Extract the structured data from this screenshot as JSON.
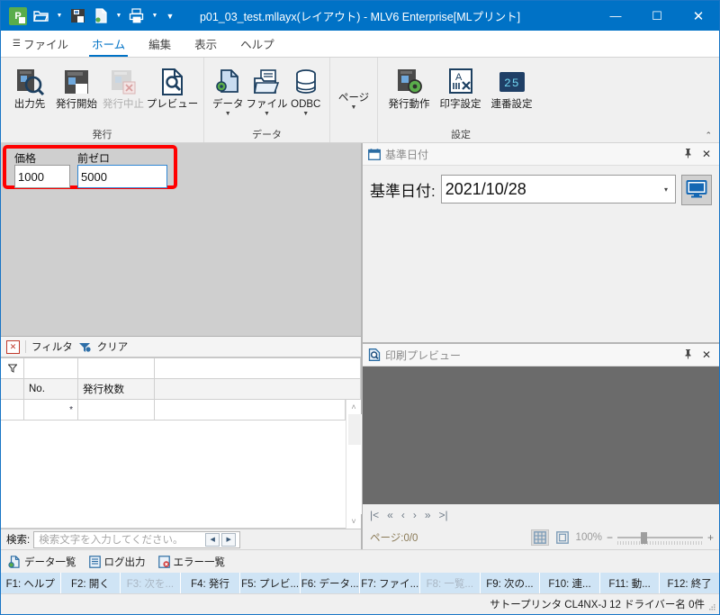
{
  "titlebar": {
    "title": "p01_03_test.mllayx(レイアウト) - MLV6 Enterprise[MLプリント]",
    "quick_access": [
      {
        "name": "app-logo",
        "label": "P"
      },
      {
        "name": "open-icon",
        "label": "open"
      },
      {
        "name": "save-icon",
        "label": "save"
      },
      {
        "name": "new-data-icon",
        "label": "new"
      },
      {
        "name": "print-icon",
        "label": "print"
      }
    ],
    "minimize": "—",
    "maximize": "☐",
    "close": "✕"
  },
  "tabs": [
    {
      "label": "ファイル",
      "active": false,
      "hamburger": true
    },
    {
      "label": "ホーム",
      "active": true
    },
    {
      "label": "編集",
      "active": false
    },
    {
      "label": "表示",
      "active": false
    },
    {
      "label": "ヘルプ",
      "active": false
    }
  ],
  "ribbon": {
    "collapse_glyph": "⌃",
    "groups": [
      {
        "name": "発行",
        "label": "発行",
        "buttons": [
          {
            "label": "出力先",
            "icon": "output-destination-icon",
            "disabled": false,
            "dropdown": false
          },
          {
            "label": "発行開始",
            "icon": "start-issue-icon",
            "disabled": false,
            "dropdown": false
          },
          {
            "label": "発行中止",
            "icon": "cancel-issue-icon",
            "disabled": true,
            "dropdown": false
          },
          {
            "label": "プレビュー",
            "icon": "preview-icon",
            "disabled": false,
            "dropdown": false
          }
        ]
      },
      {
        "name": "データ",
        "label": "データ",
        "buttons": [
          {
            "label": "データ",
            "icon": "data-icon",
            "disabled": false,
            "dropdown": true
          },
          {
            "label": "ファイル",
            "icon": "file-folder-icon",
            "disabled": false,
            "dropdown": true
          },
          {
            "label": "ODBC",
            "icon": "database-icon",
            "disabled": false,
            "dropdown": true
          }
        ]
      },
      {
        "name": "ページ",
        "label": "",
        "buttons": [
          {
            "label": "ページ",
            "icon": "page-icon",
            "disabled": false,
            "dropdown": true
          }
        ]
      },
      {
        "name": "設定",
        "label": "設定",
        "buttons": [
          {
            "label": "発行動作",
            "icon": "issue-action-icon",
            "disabled": false,
            "dropdown": false
          },
          {
            "label": "印字設定",
            "icon": "print-settings-icon",
            "disabled": false,
            "dropdown": false
          },
          {
            "label": "連番設定",
            "icon": "serial-number-icon",
            "disabled": false,
            "dropdown": false
          }
        ]
      }
    ]
  },
  "form": {
    "fields": [
      {
        "label": "価格",
        "value": "1000",
        "focused": false
      },
      {
        "label": "前ゼロ",
        "value": "5000",
        "focused": true
      }
    ]
  },
  "filterbar": {
    "close_glyph": "✕",
    "filter_label": "フィルタ",
    "clear_label": "クリア",
    "clear_icon": "clear-filter-icon",
    "filter_row_icon": "funnel-icon"
  },
  "grid": {
    "columns": [
      "",
      "No.",
      "発行枚数",
      ""
    ],
    "new_row_marker": "*",
    "rows": []
  },
  "search": {
    "label": "検索:",
    "placeholder": "検索文字を入力してください。",
    "prev_glyph": "◀",
    "next_glyph": "▶"
  },
  "bottom_tools": [
    {
      "label": "データ一覧",
      "icon": "data-list-icon"
    },
    {
      "label": "ログ出力",
      "icon": "log-output-icon"
    },
    {
      "label": "エラー一覧",
      "icon": "error-list-icon"
    }
  ],
  "function_keys": [
    {
      "label": "F1: ヘルプ",
      "disabled": false
    },
    {
      "label": "F2: 開く",
      "disabled": false
    },
    {
      "label": "F3: 次を...",
      "disabled": true
    },
    {
      "label": "F4: 発行",
      "disabled": false
    },
    {
      "label": "F5: プレビ...",
      "disabled": false
    },
    {
      "label": "F6: データ...",
      "disabled": false
    },
    {
      "label": "F7: ファイ...",
      "disabled": false
    },
    {
      "label": "F8: 一覧...",
      "disabled": true
    },
    {
      "label": "F9: 次の...",
      "disabled": false
    },
    {
      "label": "F10: 連...",
      "disabled": false
    },
    {
      "label": "F11: 動...",
      "disabled": false
    },
    {
      "label": "F12: 終了",
      "disabled": false
    }
  ],
  "statusbar": {
    "text": "サトープリンタ  CL4NX-J 12  ドライバー名  0件"
  },
  "date_panel": {
    "title": "基準日付",
    "title_icon": "calendar-icon",
    "pin_glyph": "📌",
    "close_glyph": "✕",
    "field_label": "基準日付:",
    "value": "2021/10/28",
    "dropdown_glyph": "▾",
    "monitor_button_icon": "monitor-icon"
  },
  "preview_panel": {
    "title": "印刷プレビュー",
    "title_icon": "preview-doc-icon",
    "pin_glyph": "📌",
    "close_glyph": "✕",
    "nav": [
      "|<",
      "«",
      "‹",
      "›",
      "»",
      ">|"
    ],
    "page_text": "ページ:0/0",
    "grid_view_icon": "grid-view-icon",
    "single_view_icon": "single-page-icon",
    "zoom_text": "100%",
    "zoom_out": "−",
    "zoom_in": "+"
  }
}
